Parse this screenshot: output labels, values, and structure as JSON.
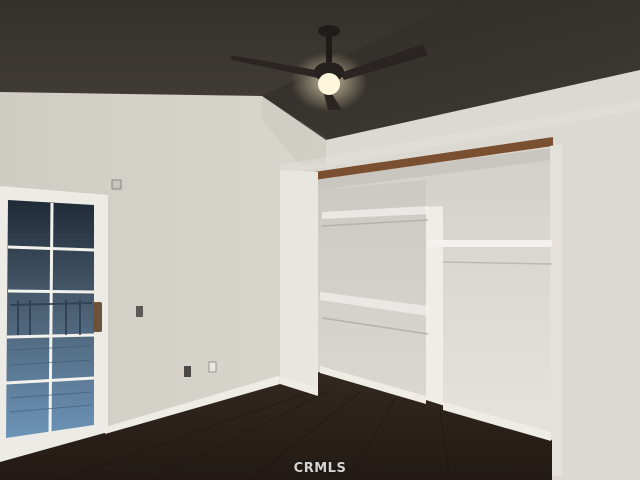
{
  "photo": {
    "scene": "empty-bedroom-with-closet",
    "watermark": "CRMLS"
  },
  "colors": {
    "ceiling": "#3a3631",
    "ceiling_slope": "#2f2c28",
    "wall_left": "#d6d3cb",
    "wall_right": "#dcd9d2",
    "closet_interior": "#e1ded8",
    "floor": "#2b2119",
    "trim": "#efece6",
    "closet_header": "#7a5030",
    "door_glass": "#5a7fa0",
    "fan_blade": "#2a2522",
    "fan_light": "#fff6dc"
  }
}
